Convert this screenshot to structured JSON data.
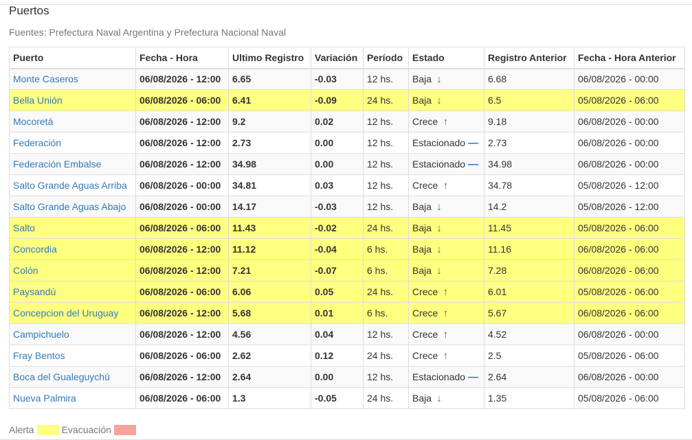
{
  "header": {
    "title": "Puertos",
    "subtitle": "Fuentes: Prefectura Naval Argentina y Prefectura Nacional Naval"
  },
  "table": {
    "columns": [
      "Puerto",
      "Fecha - Hora",
      "Ultimo Registro",
      "Variación",
      "Período",
      "Estado",
      "Registro Anterior",
      "Fecha - Hora Anterior"
    ],
    "rows": [
      {
        "puerto": "Monte Caseros",
        "fecha": "06/08/2026 - 12:00",
        "ultimo": "6.65",
        "variacion": "-0.03",
        "periodo": "12 hs.",
        "estado": "Baja",
        "trend": "down",
        "anterior": "6.68",
        "fecha_anterior": "06/08/2026 - 00:00",
        "alert": false
      },
      {
        "puerto": "Bella Unión",
        "fecha": "06/08/2026 - 06:00",
        "ultimo": "6.41",
        "variacion": "-0.09",
        "periodo": "24 hs.",
        "estado": "Baja",
        "trend": "down",
        "anterior": "6.5",
        "fecha_anterior": "05/08/2026 - 06:00",
        "alert": true
      },
      {
        "puerto": "Mocoretá",
        "fecha": "06/08/2026 - 12:00",
        "ultimo": "9.2",
        "variacion": "0.02",
        "periodo": "12 hs.",
        "estado": "Crece",
        "trend": "up",
        "anterior": "9.18",
        "fecha_anterior": "06/08/2026 - 00:00",
        "alert": false
      },
      {
        "puerto": "Federación",
        "fecha": "06/08/2026 - 12:00",
        "ultimo": "2.73",
        "variacion": "0.00",
        "periodo": "12 hs.",
        "estado": "Estacionado",
        "trend": "flat",
        "anterior": "2.73",
        "fecha_anterior": "06/08/2026 - 00:00",
        "alert": false
      },
      {
        "puerto": "Federación Embalse",
        "fecha": "06/08/2026 - 12:00",
        "ultimo": "34.98",
        "variacion": "0.00",
        "periodo": "12 hs.",
        "estado": "Estacionado",
        "trend": "flat",
        "anterior": "34.98",
        "fecha_anterior": "06/08/2026 - 00:00",
        "alert": false
      },
      {
        "puerto": "Salto Grande Aguas Arriba",
        "fecha": "06/08/2026 - 00:00",
        "ultimo": "34.81",
        "variacion": "0.03",
        "periodo": "12 hs.",
        "estado": "Crece",
        "trend": "up",
        "anterior": "34.78",
        "fecha_anterior": "05/08/2026 - 12:00",
        "alert": false
      },
      {
        "puerto": "Salto Grande Aguas Abajo",
        "fecha": "06/08/2026 - 00:00",
        "ultimo": "14.17",
        "variacion": "-0.03",
        "periodo": "12 hs.",
        "estado": "Baja",
        "trend": "down",
        "anterior": "14.2",
        "fecha_anterior": "05/08/2026 - 12:00",
        "alert": false
      },
      {
        "puerto": "Salto",
        "fecha": "06/08/2026 - 06:00",
        "ultimo": "11.43",
        "variacion": "-0.02",
        "periodo": "24 hs.",
        "estado": "Baja",
        "trend": "down",
        "anterior": "11.45",
        "fecha_anterior": "05/08/2026 - 06:00",
        "alert": true
      },
      {
        "puerto": "Concordia",
        "fecha": "06/08/2026 - 12:00",
        "ultimo": "11.12",
        "variacion": "-0.04",
        "periodo": "6 hs.",
        "estado": "Baja",
        "trend": "down",
        "anterior": "11.16",
        "fecha_anterior": "06/08/2026 - 06:00",
        "alert": true
      },
      {
        "puerto": "Colón",
        "fecha": "06/08/2026 - 12:00",
        "ultimo": "7.21",
        "variacion": "-0.07",
        "periodo": "6 hs.",
        "estado": "Baja",
        "trend": "down",
        "anterior": "7.28",
        "fecha_anterior": "06/08/2026 - 06:00",
        "alert": true
      },
      {
        "puerto": "Paysandú",
        "fecha": "06/08/2026 - 06:00",
        "ultimo": "6.06",
        "variacion": "0.05",
        "periodo": "24 hs.",
        "estado": "Crece",
        "trend": "up",
        "anterior": "6.01",
        "fecha_anterior": "05/08/2026 - 06:00",
        "alert": true
      },
      {
        "puerto": "Concepcion del Uruguay",
        "fecha": "06/08/2026 - 12:00",
        "ultimo": "5.68",
        "variacion": "0.01",
        "periodo": "6 hs.",
        "estado": "Crece",
        "trend": "up",
        "anterior": "5.67",
        "fecha_anterior": "06/08/2026 - 06:00",
        "alert": true
      },
      {
        "puerto": "Campichuelo",
        "fecha": "06/08/2026 - 12:00",
        "ultimo": "4.56",
        "variacion": "0.04",
        "periodo": "12 hs.",
        "estado": "Crece",
        "trend": "up",
        "anterior": "4.52",
        "fecha_anterior": "06/08/2026 - 00:00",
        "alert": false
      },
      {
        "puerto": "Fray Bentos",
        "fecha": "06/08/2026 - 06:00",
        "ultimo": "2.62",
        "variacion": "0.12",
        "periodo": "24 hs.",
        "estado": "Crece",
        "trend": "up",
        "anterior": "2.5",
        "fecha_anterior": "05/08/2026 - 06:00",
        "alert": false
      },
      {
        "puerto": "Boca del Gualeguychú",
        "fecha": "06/08/2026 - 12:00",
        "ultimo": "2.64",
        "variacion": "0.00",
        "periodo": "12 hs.",
        "estado": "Estacionado",
        "trend": "flat",
        "anterior": "2.64",
        "fecha_anterior": "06/08/2026 - 00:00",
        "alert": false
      },
      {
        "puerto": "Nueva Palmira",
        "fecha": "06/08/2026 - 06:00",
        "ultimo": "1.3",
        "variacion": "-0.05",
        "periodo": "24 hs.",
        "estado": "Baja",
        "trend": "down",
        "anterior": "1.35",
        "fecha_anterior": "05/08/2026 - 06:00",
        "alert": false
      }
    ]
  },
  "legend": {
    "alerta_label": "Alerta",
    "alerta_color": "#ffff80",
    "evacuacion_label": "Evacuación",
    "evacuacion_color": "#f5a39b"
  },
  "icons": {
    "down": "arrow-down-icon",
    "up": "arrow-up-icon",
    "flat": "dash-icon"
  }
}
